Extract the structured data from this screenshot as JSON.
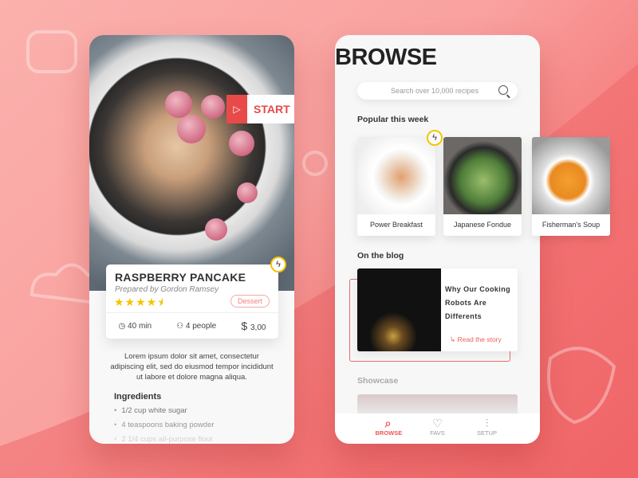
{
  "colors": {
    "accent": "#e84a4a",
    "star": "#f5c400"
  },
  "recipe": {
    "start_label": "START",
    "title": "RASPBERRY PANCAKE",
    "author": "Prepared by Gordon Ramsey",
    "rating": 4.5,
    "rating_max": 5,
    "category": "Dessert",
    "time": "40 min",
    "servings": "4 people",
    "price": "3,00",
    "description": "Lorem ipsum dolor sit amet, consectetur adipiscing elit, sed do eiusmod tempor incididunt ut labore et dolore magna aliqua.",
    "ingredients_heading": "Ingredients",
    "ingredients": [
      "1/2 cup white sugar",
      "4 teaspoons baking powder",
      "2 1/4 cups all-purpose flour"
    ]
  },
  "browse": {
    "title": "BROWSE",
    "search_placeholder": "Search over 10,000 recipes",
    "popular_heading": "Popular this week",
    "popular": [
      {
        "label": "Power Breakfast"
      },
      {
        "label": "Japanese Fondue"
      },
      {
        "label": "Fisherman's Soup"
      }
    ],
    "blog_heading": "On the blog",
    "blog": {
      "title": "Why Our Cooking Robots Are Differents",
      "link": "Read the story"
    },
    "showcase_heading": "Showcase",
    "nav": [
      {
        "label": "BROWSE",
        "icon": "search-icon",
        "active": true
      },
      {
        "label": "FAVS",
        "icon": "heart-icon"
      },
      {
        "label": "SETUP",
        "icon": "sliders-icon"
      }
    ]
  }
}
